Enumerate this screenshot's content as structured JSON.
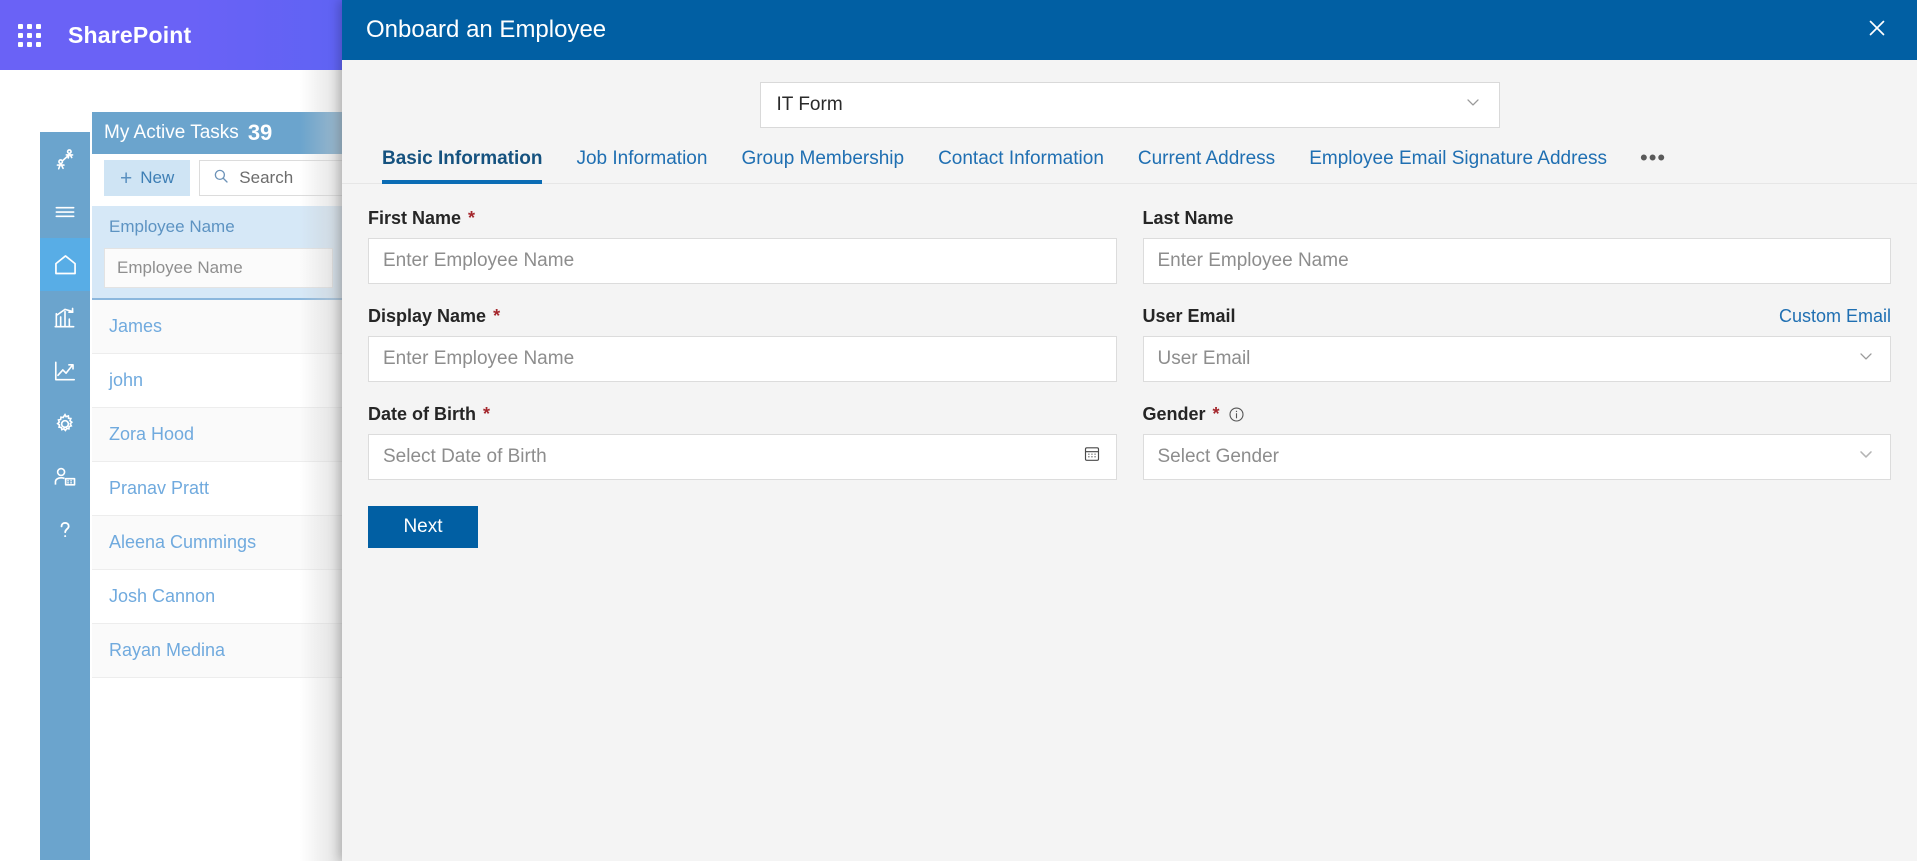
{
  "suite": {
    "waffle_icon": "app-launcher-icon",
    "brand": "SharePoint"
  },
  "sidebar": {
    "items": [
      {
        "icon": "people-activity-icon",
        "active": false
      },
      {
        "icon": "hamburger-menu-icon",
        "active": false
      },
      {
        "icon": "home-icon",
        "active": true
      },
      {
        "icon": "bar-chart-icon",
        "active": false
      },
      {
        "icon": "line-chart-icon",
        "active": false
      },
      {
        "icon": "gear-icon",
        "active": false
      },
      {
        "icon": "user-admin-icon",
        "active": false
      },
      {
        "icon": "help-question-icon",
        "active": false
      }
    ]
  },
  "task_list": {
    "title": "My Active Tasks",
    "count": "39",
    "new_label": "New",
    "new_icon": "plus-icon",
    "search_icon": "search-icon",
    "search_placeholder": "Search",
    "column_header": "Employee Name",
    "filter_placeholder": "Employee Name",
    "rows": [
      {
        "name": "James"
      },
      {
        "name": "john"
      },
      {
        "name": "Zora Hood"
      },
      {
        "name": "Pranav Pratt"
      },
      {
        "name": "Aleena Cummings"
      },
      {
        "name": "Josh Cannon"
      },
      {
        "name": "Rayan Medina"
      }
    ]
  },
  "modal": {
    "title": "Onboard an Employee",
    "close_icon": "close-icon",
    "form_selector": {
      "value": "IT Form",
      "chevron_icon": "chevron-down-icon"
    },
    "tabs": [
      {
        "label": "Basic Information",
        "active": true
      },
      {
        "label": "Job Information",
        "active": false
      },
      {
        "label": "Group Membership",
        "active": false
      },
      {
        "label": "Contact Information",
        "active": false
      },
      {
        "label": "Current Address",
        "active": false
      },
      {
        "label": "Employee Email Signature Address",
        "active": false
      }
    ],
    "tabs_overflow": "•••",
    "fields": {
      "first_name": {
        "label": "First Name",
        "required": "*",
        "placeholder": "Enter Employee Name",
        "value": ""
      },
      "last_name": {
        "label": "Last Name",
        "required": "",
        "placeholder": "Enter Employee Name",
        "value": ""
      },
      "display_name": {
        "label": "Display Name",
        "required": "*",
        "placeholder": "Enter Employee Name",
        "value": ""
      },
      "user_email": {
        "label": "User Email",
        "required": "",
        "placeholder": "User Email",
        "value": "",
        "action_link": "Custom Email",
        "chevron_icon": "chevron-down-icon"
      },
      "date_of_birth": {
        "label": "Date of Birth",
        "required": "*",
        "placeholder": "Select Date of Birth",
        "value": "",
        "calendar_icon": "calendar-icon"
      },
      "gender": {
        "label": "Gender",
        "required": "*",
        "placeholder": "Select Gender",
        "value": "",
        "info_icon": "info-circle-icon",
        "chevron_icon": "chevron-down-icon"
      }
    },
    "next_label": "Next"
  },
  "colors": {
    "suite_purple": "#6a62f6",
    "modal_header_blue": "#015fa3",
    "accent_blue": "#0b6cb4",
    "sidebar_blue": "#6ba4cd",
    "sidebar_active": "#58ade6",
    "required_red": "#a4262c",
    "link_blue": "#1f6fb2",
    "list_row_blue": "#70aade",
    "modal_bg": "#f4f4f4"
  }
}
